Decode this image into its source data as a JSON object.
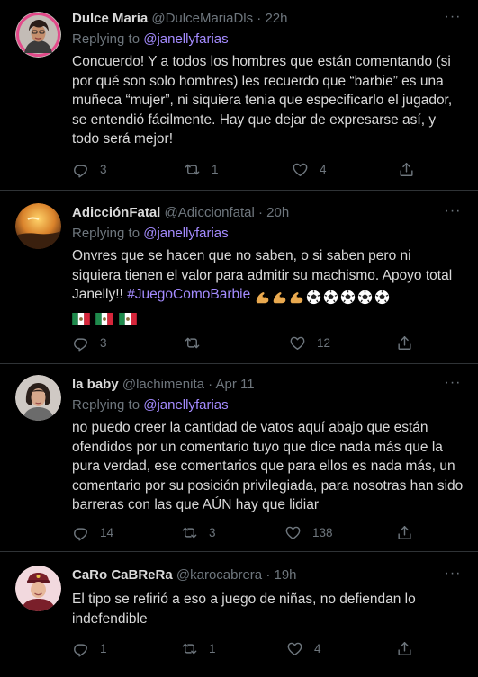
{
  "tweets": [
    {
      "name": "Dulce María",
      "handle": "@DulceMariaDls",
      "time": "22h",
      "reply_prefix": "Replying to",
      "reply_to": "@janellyfarias",
      "text": "Concuerdo! Y a todos los hombres que están comentando (si por qué son solo hombres) les recuerdo que “barbie” es una muñeca “mujer”, ni siquiera tenia que especificarlo el jugador, se entendió fácilmente. Hay que dejar de expresarse así, y todo será mejor!",
      "replies": "3",
      "retweets": "1",
      "likes": "4"
    },
    {
      "name": "AdicciónFatal",
      "handle": "@Adiccionfatal",
      "time": "20h",
      "reply_prefix": "Replying to",
      "reply_to": "@janellyfarias",
      "text": "Onvres que se hacen que no saben, o si saben pero ni siquiera tienen el valor para admitir su machismo. Apoyo total Janelly!!",
      "hashtag": "#JuegoComoBarbie",
      "replies": "3",
      "retweets": "",
      "likes": "12"
    },
    {
      "name": "la baby",
      "handle": "@lachimenita",
      "time": "Apr 11",
      "reply_prefix": "Replying to",
      "reply_to": "@janellyfarias",
      "text": "no puedo creer la cantidad de vatos aquí abajo que están ofendidos por un comentario tuyo que dice nada más que la pura verdad, ese comentarios que para ellos es nada más, un comentario por su posición privilegiada, para nosotras han sido barreras con las que AÚN hay que lidiar",
      "replies": "14",
      "retweets": "3",
      "likes": "138"
    },
    {
      "name": "CaRo CaBReRa",
      "handle": "@karocabrera",
      "time": "19h",
      "reply_prefix": "",
      "reply_to": "",
      "text": "El tipo se refirió a eso a juego de niñas, no defiendan lo indefendible",
      "replies": "1",
      "retweets": "1",
      "likes": "4"
    }
  ],
  "ui": {
    "separator": "·",
    "more": "···"
  },
  "icons": [
    "reply-icon",
    "retweet-icon",
    "like-icon",
    "share-icon",
    "more-icon",
    "flexed-biceps-icon",
    "soccer-ball-icon",
    "mexico-flag-icon"
  ],
  "colors": {
    "background": "#000000",
    "text": "#d9d9d9",
    "muted": "#6e767d",
    "link": "#a48bff",
    "border": "#2f3336"
  }
}
